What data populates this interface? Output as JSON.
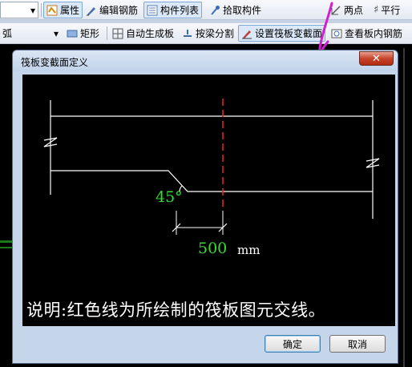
{
  "toolbar1": {
    "properties": "属性",
    "edit_rebar": "编辑钢筋",
    "component_list": "构件列表",
    "pick_component": "拾取构件",
    "two_points": "两点",
    "parallel": "平行"
  },
  "toolbar2": {
    "combo_fragment": "弧",
    "rectangle": "矩形",
    "auto_generate": "自动生成板",
    "split_by_beam": "按梁分割",
    "set_raft_section": "设置筏板变截面",
    "view_slab_rebar": "查看板内钢筋"
  },
  "dialog": {
    "title": "筏板变截面定义",
    "angle_label": "45°",
    "dimension_value": "500",
    "dimension_unit": "mm",
    "note": "说明:红色线为所绘制的筏板图元交线。",
    "ok": "确定",
    "cancel": "取消"
  },
  "colors": {
    "intersection_line": "#e02020",
    "annotation_text": "#33dd33",
    "drawing_line": "#ffffff",
    "highlight_stroke": "#d020d0"
  }
}
